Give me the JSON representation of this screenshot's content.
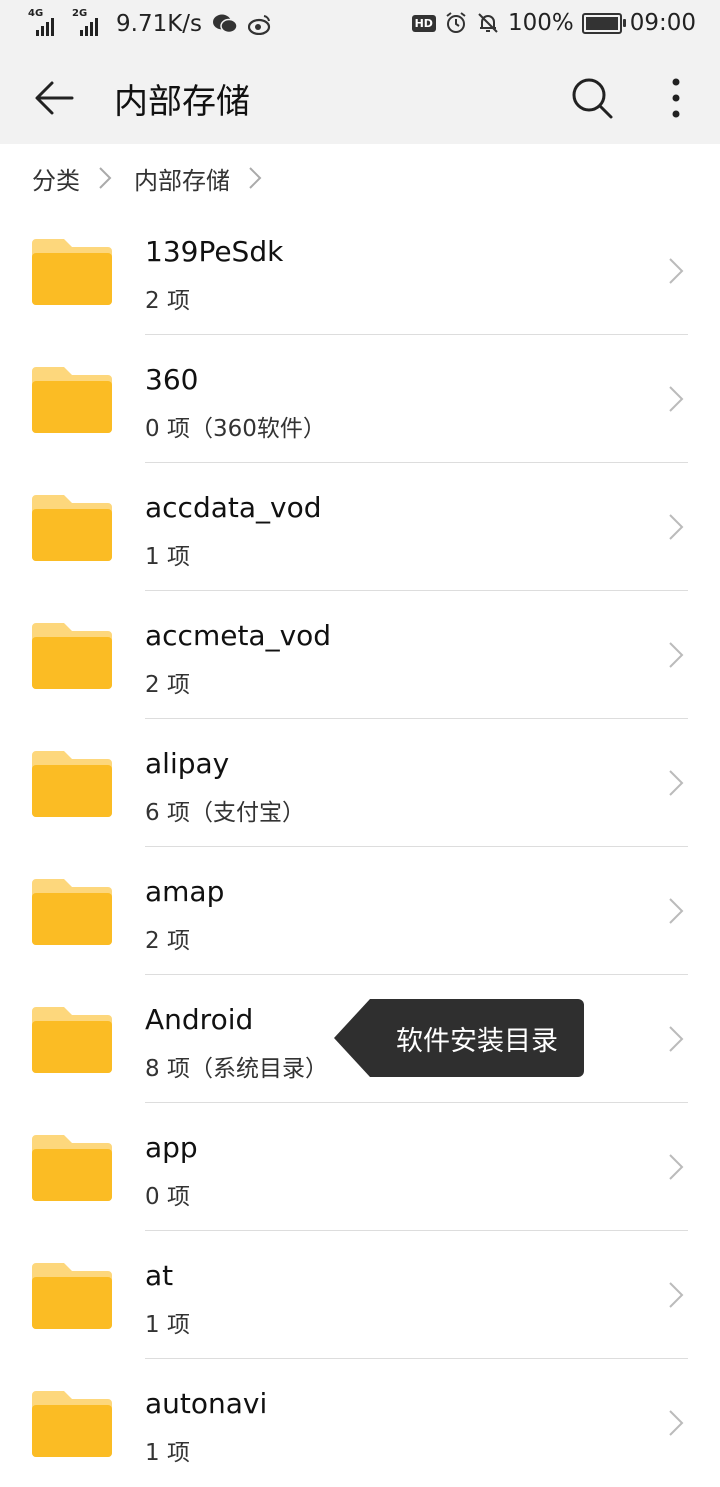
{
  "status_bar": {
    "net1": "4G",
    "net2": "2G",
    "speed": "9.71K/s",
    "hd": "HD",
    "battery": "100%",
    "time": "09:00"
  },
  "app_bar": {
    "title": "内部存储"
  },
  "breadcrumb": [
    "分类",
    "内部存储"
  ],
  "folders": [
    {
      "name": "139PeSdk",
      "meta": "2 项"
    },
    {
      "name": "360",
      "meta": "0 项（360软件）"
    },
    {
      "name": "accdata_vod",
      "meta": "1 项"
    },
    {
      "name": "accmeta_vod",
      "meta": "2 项"
    },
    {
      "name": "alipay",
      "meta": "6 项（支付宝）"
    },
    {
      "name": "amap",
      "meta": "2 项"
    },
    {
      "name": "Android",
      "meta": "8 项（系统目录）"
    },
    {
      "name": "app",
      "meta": "0 项"
    },
    {
      "name": "at",
      "meta": "1 项"
    },
    {
      "name": "autonavi",
      "meta": "1 项"
    }
  ],
  "tooltip": {
    "text": "软件安装目录"
  },
  "colors": {
    "folder_back": "#FDD77C",
    "folder_front": "#FBBC24",
    "bar_bg": "#F2F2F2",
    "tooltip_bg": "#2F2F2F"
  }
}
